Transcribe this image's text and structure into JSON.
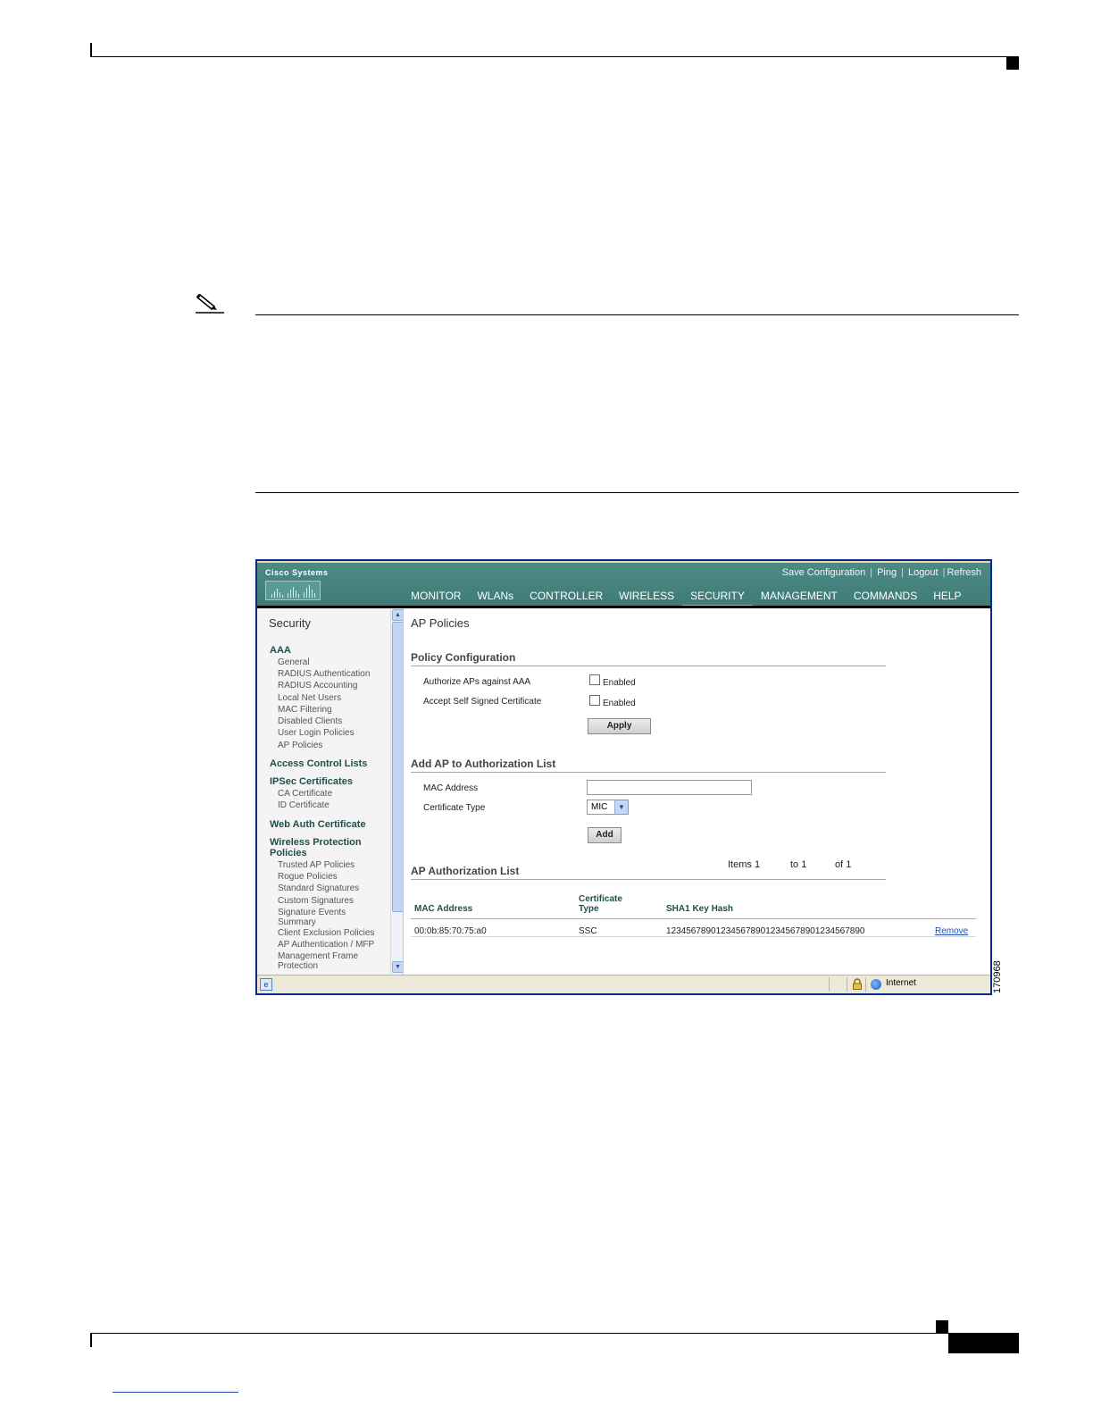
{
  "figure_id": "170968",
  "app": {
    "logo_text": "Cisco Systems",
    "util_links": [
      "Save Configuration",
      "Ping",
      "Logout",
      "Refresh"
    ],
    "nav": [
      {
        "label": "MONITOR",
        "active": false
      },
      {
        "label": "WLANs",
        "active": false
      },
      {
        "label": "CONTROLLER",
        "active": false
      },
      {
        "label": "WIRELESS",
        "active": false
      },
      {
        "label": "SECURITY",
        "active": true
      },
      {
        "label": "MANAGEMENT",
        "active": false
      },
      {
        "label": "COMMANDS",
        "active": false
      },
      {
        "label": "HELP",
        "active": false
      }
    ]
  },
  "sidebar": {
    "title": "Security",
    "groups": [
      {
        "label": "AAA",
        "items": [
          "General",
          "RADIUS Authentication",
          "RADIUS Accounting",
          "Local Net Users",
          "MAC Filtering",
          "Disabled Clients",
          "User Login Policies",
          "AP Policies"
        ]
      },
      {
        "label": "Access Control Lists",
        "items": []
      },
      {
        "label": "IPSec Certificates",
        "items": [
          "CA Certificate",
          "ID Certificate"
        ]
      },
      {
        "label": "Web Auth Certificate",
        "items": []
      },
      {
        "label": "Wireless Protection Policies",
        "items": [
          "Trusted AP Policies",
          "Rogue Policies",
          "Standard Signatures",
          "Custom Signatures",
          "Signature Events Summary",
          "Client Exclusion Policies",
          "AP Authentication / MFP",
          "Management Frame Protection"
        ]
      }
    ]
  },
  "main": {
    "page_title": "AP Policies",
    "policy": {
      "title": "Policy Configuration",
      "authorize_label": "Authorize APs against AAA",
      "self_signed_label": "Accept Self Signed Certificate",
      "enabled_label": "Enabled",
      "apply_label": "Apply"
    },
    "add": {
      "title": "Add AP to Authorization List",
      "mac_label": "MAC Address",
      "mac_value": "",
      "cert_label": "Certificate Type",
      "cert_selected": "MIC",
      "add_label": "Add"
    },
    "list": {
      "title": "AP Authorization List",
      "pager": {
        "items": "Items 1",
        "to": "to 1",
        "of": "of 1"
      },
      "columns": [
        "MAC Address",
        "Certificate Type",
        "SHA1 Key Hash"
      ],
      "rows": [
        {
          "mac": "00:0b:85:70:75:a0",
          "cert": "SSC",
          "hash": "1234567890123456789012345678901234567890",
          "action": "Remove"
        }
      ]
    }
  },
  "statusbar": {
    "zone": "Internet"
  }
}
